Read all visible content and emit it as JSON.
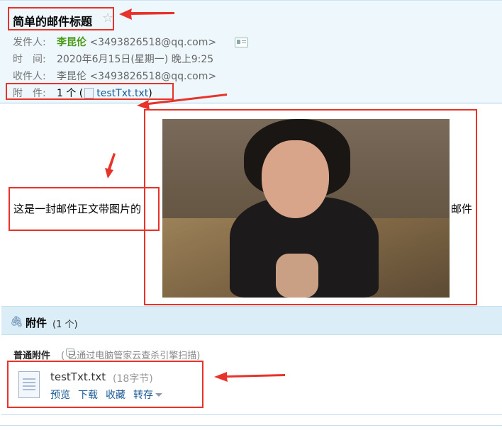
{
  "mail": {
    "subject": "简单的邮件标题",
    "star_icon": "star-icon",
    "sender_label": "发件人:",
    "sender_name": "李昆伦",
    "sender_email": "<3493826518@qq.com>",
    "time_label": "时　间:",
    "time_value": "2020年6月15日(星期一) 晚上9:25",
    "recipient_label": "收件人:",
    "recipient_value": "李昆伦 <3493826518@qq.com>",
    "attachment_label": "附　件:",
    "attachment_count_prefix": "1 个 (",
    "attachment_name": "testTxt.txt",
    "attachment_count_suffix": ")"
  },
  "body": {
    "text_left": "这是一封邮件正文带图片的",
    "text_right": "邮件",
    "image": "photo-of-woman"
  },
  "attachments": {
    "title": "附件",
    "count": "(1 个)",
    "normal_label": "普通附件",
    "scan_note": "( 已通过电脑管家云查杀引擎扫描)",
    "file_name": "testTxt.txt",
    "file_size": "(18字节)",
    "actions": [
      "预览",
      "下载",
      "收藏",
      "转存"
    ]
  },
  "colors": {
    "annotation": "#e8332b",
    "link": "#1a5a96",
    "sender": "#4a9a16",
    "header_bg": "#eef7fc"
  }
}
